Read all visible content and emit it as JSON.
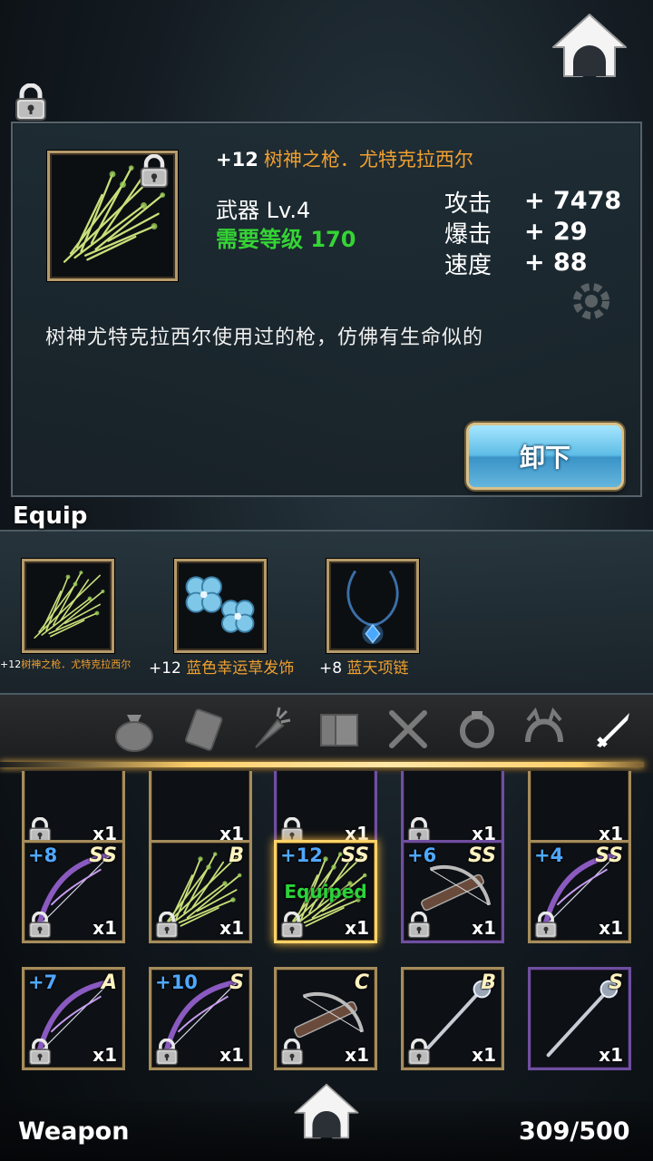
{
  "selected_item": {
    "plus": "+12",
    "name": "树神之枪．尤特克拉西尔",
    "type_level": "武器 Lv.4",
    "required_level": "需要等级 170",
    "stats": [
      {
        "label": "攻击",
        "value": "+ 7478"
      },
      {
        "label": "爆击",
        "value": "+ 29"
      },
      {
        "label": "速度",
        "value": "+ 88"
      }
    ],
    "description": "树神尤特克拉西尔使用过的枪，仿佛有生命似的",
    "unequip_label": "卸下"
  },
  "equip": {
    "title": "Equip",
    "slots": [
      {
        "plus": "+12",
        "name": "树神之枪．尤特克拉西尔"
      },
      {
        "plus": "+12",
        "name": "蓝色幸运草发饰"
      },
      {
        "plus": "+8",
        "name": "蓝天项链"
      }
    ]
  },
  "tabs": [
    "bag-icon",
    "scroll-icon",
    "carrot-icon",
    "book-icon",
    "fork-knife-icon",
    "ring-icon",
    "headband-icon",
    "sword-icon"
  ],
  "inventory": {
    "row0": [
      {
        "qty": "x1"
      },
      {
        "qty": "x1"
      },
      {
        "qty": "x1"
      },
      {
        "qty": "x1"
      },
      {
        "qty": "x1"
      }
    ],
    "row1": [
      {
        "plus": "+8",
        "rank": "SS",
        "qty": "x1"
      },
      {
        "plus": "",
        "rank": "B",
        "qty": "x1"
      },
      {
        "plus": "+12",
        "rank": "SS",
        "qty": "x1",
        "status": "Equiped"
      },
      {
        "plus": "+6",
        "rank": "SS",
        "qty": "x1"
      },
      {
        "plus": "+4",
        "rank": "SS",
        "qty": "x1"
      }
    ],
    "row2": [
      {
        "plus": "+7",
        "rank": "A",
        "qty": "x1"
      },
      {
        "plus": "+10",
        "rank": "S",
        "qty": "x1"
      },
      {
        "plus": "",
        "rank": "C",
        "qty": "x1"
      },
      {
        "plus": "",
        "rank": "B",
        "qty": "x1"
      },
      {
        "plus": "",
        "rank": "S",
        "qty": "x1"
      }
    ]
  },
  "footer": {
    "category": "Weapon",
    "count": "309/500"
  },
  "colors": {
    "accent_gold": "#f0a030",
    "required_green": "#35d435",
    "plus_blue": "#4fa8ff",
    "equiped_green": "#29d43a"
  }
}
